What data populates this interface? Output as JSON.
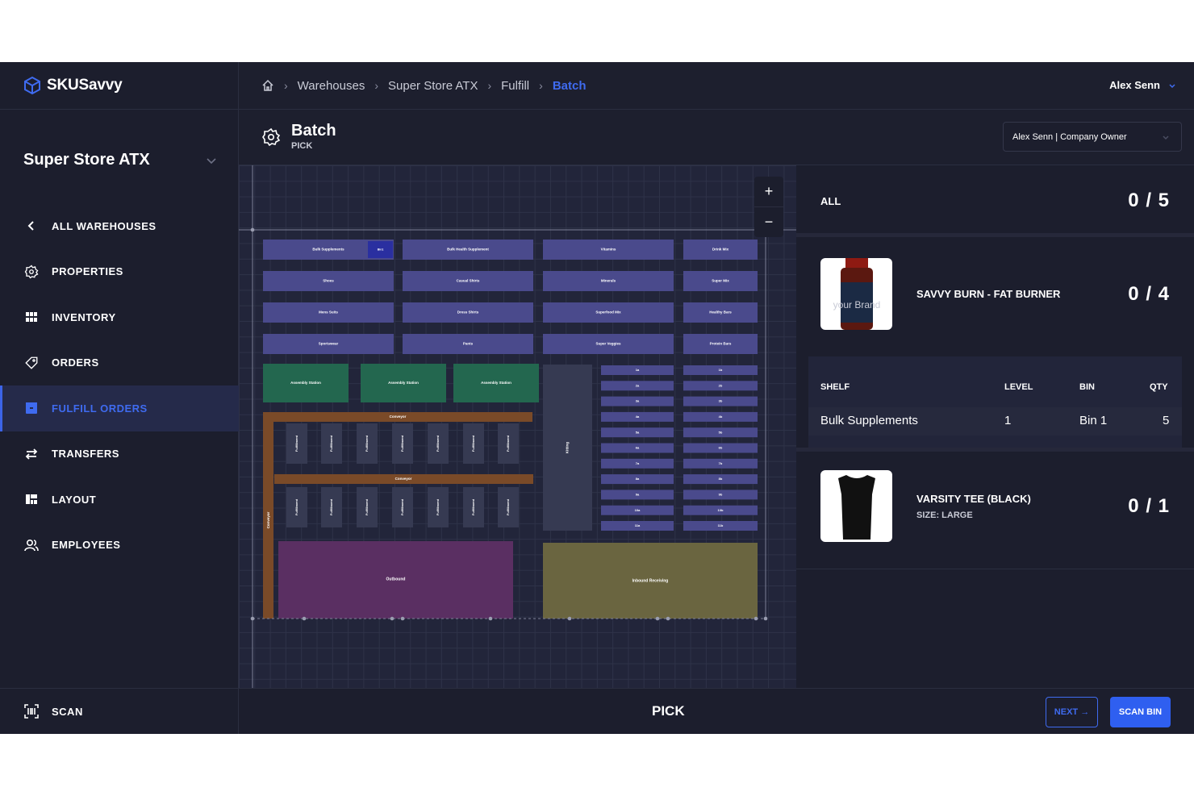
{
  "app": {
    "name": "SKUSavvy"
  },
  "sidebar": {
    "store_name": "Super Store ATX",
    "items": [
      {
        "label": "ALL WAREHOUSES",
        "icon": "chevron-left-icon"
      },
      {
        "label": "PROPERTIES",
        "icon": "gear-icon"
      },
      {
        "label": "INVENTORY",
        "icon": "grid-icon"
      },
      {
        "label": "ORDERS",
        "icon": "tag-icon"
      },
      {
        "label": "FULFILL ORDERS",
        "icon": "box-icon",
        "active": true
      },
      {
        "label": "TRANSFERS",
        "icon": "swap-icon"
      },
      {
        "label": "LAYOUT",
        "icon": "layout-icon"
      },
      {
        "label": "EMPLOYEES",
        "icon": "users-icon"
      }
    ],
    "scan_label": "SCAN"
  },
  "breadcrumb": [
    "Warehouses",
    "Super Store ATX",
    "Fulfill",
    "Batch"
  ],
  "user": {
    "name": "Alex Senn"
  },
  "header": {
    "title": "Batch",
    "subtitle": "PICK",
    "role_select": "Alex Senn | Company Owner"
  },
  "map": {
    "zoom_in": "+",
    "zoom_out": "−",
    "shelves": {
      "col1": [
        "Bulk Supplements",
        "Shoes",
        "Mens Suits",
        "Sportswear"
      ],
      "col1_bin": "Bin1",
      "col2": [
        "Bulk Health Supplement",
        "Casual Shirts",
        "Dress Shirts",
        "Pants"
      ],
      "col3": [
        "Vitamins",
        "Minerals",
        "Superfood Mix",
        "Super Veggies"
      ],
      "col4": [
        "Drink Mix",
        "Super Mix",
        "Healthy Bars",
        "Protein Bars"
      ]
    },
    "assembly": [
      "Assembly Station",
      "Assembly Station",
      "Assembly Station"
    ],
    "conveyor_top": "Conveyor",
    "conveyor_mid": "Conveyor",
    "conveyor_side": "Conveyor",
    "fulfillment_label": "Fulfillment",
    "kitting": "Kitting",
    "bins_a": [
      "1a",
      "2a",
      "3a",
      "4a",
      "5a",
      "6a",
      "7a",
      "8a",
      "9a",
      "10a",
      "11a"
    ],
    "bins_b": [
      "1b",
      "2b",
      "3b",
      "4b",
      "5b",
      "6b",
      "7b",
      "8b",
      "9b",
      "10b",
      "11b"
    ],
    "outbound": "Outbound",
    "inbound": "Inbound Receiving"
  },
  "panel": {
    "all_label": "ALL",
    "all_count": "0 / 5",
    "items": [
      {
        "name": "SAVVY BURN - FAT BURNER",
        "count": "0 / 4",
        "thumb_text": "your Brand",
        "locations_header": {
          "shelf": "SHELF",
          "level": "LEVEL",
          "bin": "BIN",
          "qty": "QTY"
        },
        "location": {
          "shelf": "Bulk Supplements",
          "level": "1",
          "bin": "Bin 1",
          "qty": "5"
        }
      },
      {
        "name": "VARSITY TEE (BLACK)",
        "subtitle": "SIZE: LARGE",
        "count": "0 / 1"
      }
    ]
  },
  "footer": {
    "title": "PICK",
    "next_label": "NEXT →",
    "scan_bin_label": "SCAN BIN"
  },
  "colors": {
    "accent": "#3f6bf0",
    "background": "#1d1f2e",
    "shelf": "#4a4a8c",
    "assembly": "#23674f",
    "conveyor": "#7a4a28",
    "outbound": "#5a2f62",
    "inbound": "#6a6540"
  }
}
